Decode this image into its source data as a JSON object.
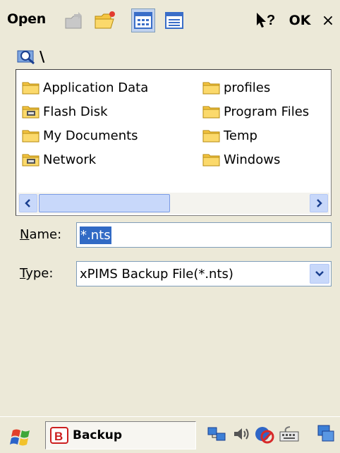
{
  "dialog": {
    "title": "Open",
    "ok_label": "OK",
    "close_label": "×",
    "path": "\\"
  },
  "files": [
    {
      "name": "Application Data",
      "icon": "folder-icon"
    },
    {
      "name": "Flash Disk",
      "icon": "storage-folder-icon"
    },
    {
      "name": "My Documents",
      "icon": "folder-icon"
    },
    {
      "name": "Network",
      "icon": "storage-folder-icon"
    },
    {
      "name": "profiles",
      "icon": "folder-icon"
    },
    {
      "name": "Program Files",
      "icon": "folder-icon"
    },
    {
      "name": "Temp",
      "icon": "folder-icon"
    },
    {
      "name": "Windows",
      "icon": "folder-icon"
    }
  ],
  "name_field": {
    "label_key": "N",
    "label_rest": "ame:",
    "value": "*.nts"
  },
  "type_field": {
    "label_key": "T",
    "label_rest": "ype:",
    "value": "xPIMS Backup File(*.nts)"
  },
  "taskbar": {
    "task_label": "Backup"
  },
  "colors": {
    "folder": "#f5c542",
    "selection": "#316ac5",
    "scroll_accent": "#c8d8fa"
  }
}
